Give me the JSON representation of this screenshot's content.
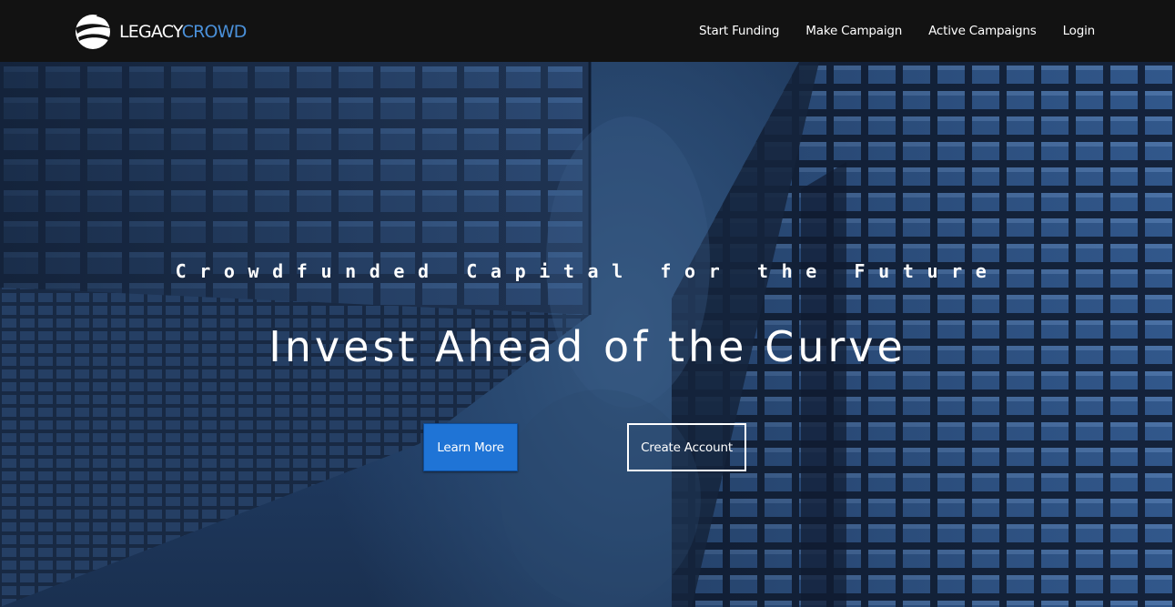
{
  "brand": {
    "name_part1": "LEGACY",
    "name_part2": "CROWD",
    "accent_color": "#4a90d9"
  },
  "nav": {
    "items": [
      {
        "label": "Start Funding"
      },
      {
        "label": "Make Campaign"
      },
      {
        "label": "Active Campaigns"
      },
      {
        "label": "Login"
      }
    ]
  },
  "hero": {
    "tagline": "Crowdfunded Capital for the Future",
    "headline": "Invest Ahead of the Curve",
    "primary_button": "Learn More",
    "secondary_button": "Create Account",
    "primary_color": "#1f74d6"
  }
}
